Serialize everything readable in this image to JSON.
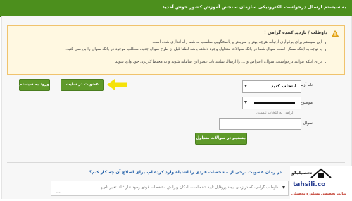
{
  "header": {
    "title": "به سیستم ارسال درخواست الکترونیکی سازمان سنجش آموزش کشور خوش آمدید"
  },
  "notice": {
    "title": "داوطلب / بازدید کننده گرامی !",
    "lines": [
      "این سیستم برای برقراری ارتباط هرچه بهتر و سریعتر و پاسخگویی مناسب به شما راه اندازی شده است",
      "با توجه به اینکه ممکن است سوال شما در بانک سوالات متداول وجود داشته باشد لطفا قبل از طرح سوال جدید، مطالب موجود در بانک سوال را بررسی کنید.",
      "برای اینکه بتوانید درخواست، سوال، اعتراض و ... را ارسال نمایید باید عضو این سامانه شوید و به محیط کاربری خود وارد شوید"
    ]
  },
  "buttons": {
    "login": "ورود به سیستم",
    "register": "عضویت در سایت",
    "search_faq": "جستجو در سوالات متداول"
  },
  "form": {
    "exam_label": "نام آزمون",
    "exam_value": "انتخاب کنید",
    "topic_label": "موضوع",
    "required_hint": "الزامی به انتخاب نیست.",
    "question_label": "سوال"
  },
  "faq": {
    "question": "در زمان عضویت برخی از مشخصات فردی را اشتباه وارد کرده ام، برای اصلاح آن چه کار کنم؟",
    "answer_preview": "داوطلب گرامی، که در زمان ایجاد پروفایل تایید شده است، امکان ویرایش مشخصات فردی وجود ندارد؛ لذا تغییر نام و ...",
    "dots": "..."
  },
  "watermark": {
    "brand": "tahsili.co",
    "line1": "تحصیلیکو",
    "line2": "سایت تخصصی مشاوره تحصیلی"
  },
  "colors": {
    "header_green": "#4c8f1d",
    "button_green": "#5f9a2a",
    "arrow_yellow": "#f5e20a",
    "notice_bg": "#fff8e1",
    "link_blue": "#1a5aa6"
  },
  "icons": {
    "warning": "warning-triangle-icon",
    "arrow": "yellow-arrow-icon"
  }
}
